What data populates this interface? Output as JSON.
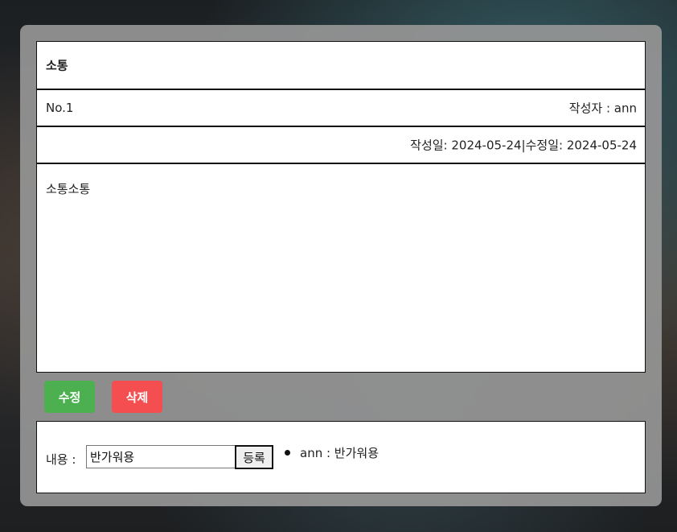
{
  "post": {
    "title": "소통",
    "number": "No.1",
    "author": "작성자 : ann",
    "dates": "작성일: 2024-05-24|수정일: 2024-05-24",
    "content": "소통소통"
  },
  "actions": {
    "edit_label": "수정",
    "delete_label": "삭제"
  },
  "comments": {
    "label": "내용 :",
    "input_value": "반가워용",
    "submit_label": "등록",
    "items": [
      {
        "text": "ann : 반가워용"
      }
    ]
  },
  "colors": {
    "edit_button": "#4caf50",
    "delete_button": "#f44e50",
    "panel": "#969696"
  }
}
